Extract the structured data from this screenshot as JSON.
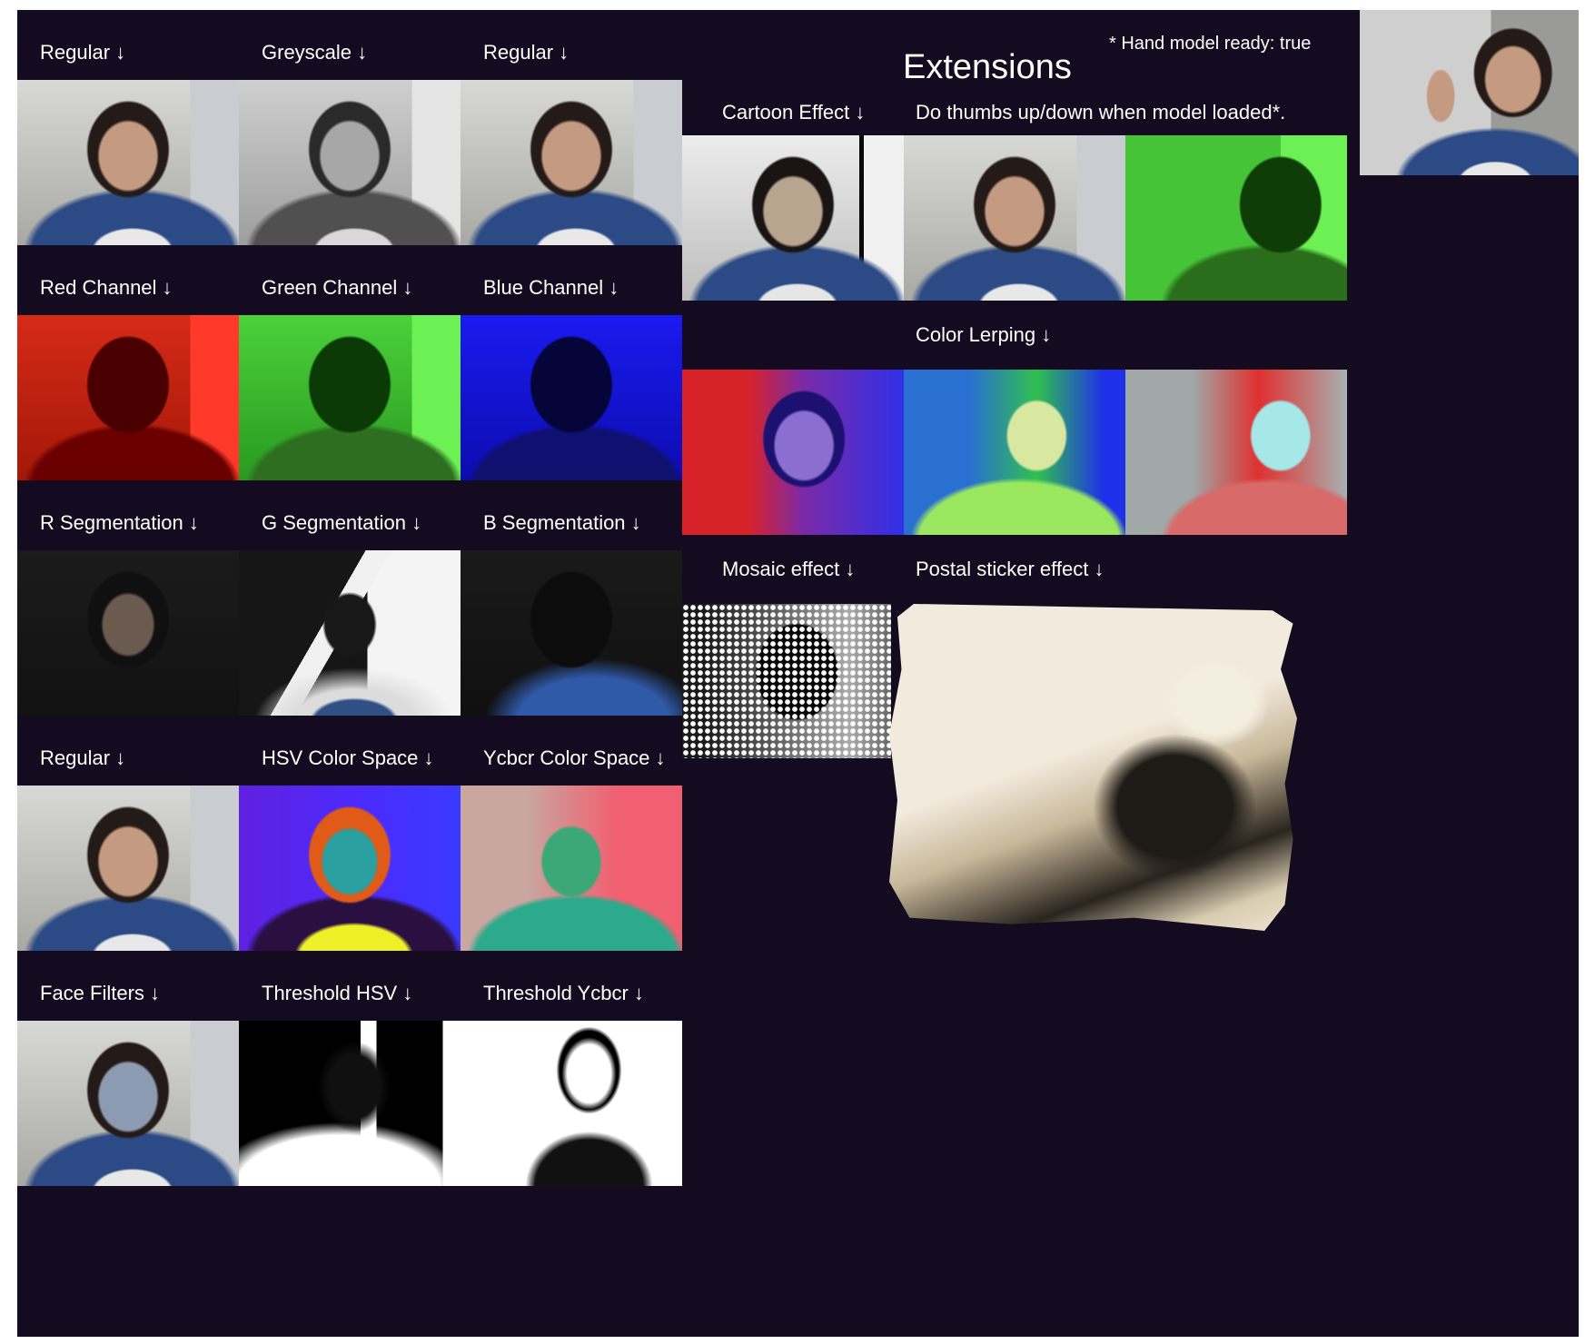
{
  "app": {
    "background": "#150b20",
    "extensions_title": "Extensions",
    "hand_model_note": "* Hand model ready: true"
  },
  "left_grid": {
    "row1": [
      "Regular  ↓",
      "Greyscale  ↓",
      "Regular  ↓"
    ],
    "row2": [
      "Red Channel  ↓",
      "Green Channel  ↓",
      "Blue Channel  ↓"
    ],
    "row3": [
      "R Segmentation  ↓",
      "G Segmentation  ↓",
      "B Segmentation  ↓"
    ],
    "row4": [
      "Regular  ↓",
      "HSV Color Space  ↓",
      "Ycbcr Color Space  ↓"
    ],
    "row5": [
      "Face Filters  ↓",
      "Threshold HSV  ↓",
      "Threshold Ycbcr  ↓"
    ]
  },
  "extensions": {
    "cartoon_label": "Cartoon Effect  ↓",
    "thumbs_label": "Do thumbs up/down when model loaded*.",
    "lerp_label": "Color Lerping  ↓",
    "mosaic_label": "Mosaic effect  ↓",
    "postal_label": "Postal sticker effect  ↓"
  },
  "icons": {
    "arrow": "arrow-down-icon"
  }
}
